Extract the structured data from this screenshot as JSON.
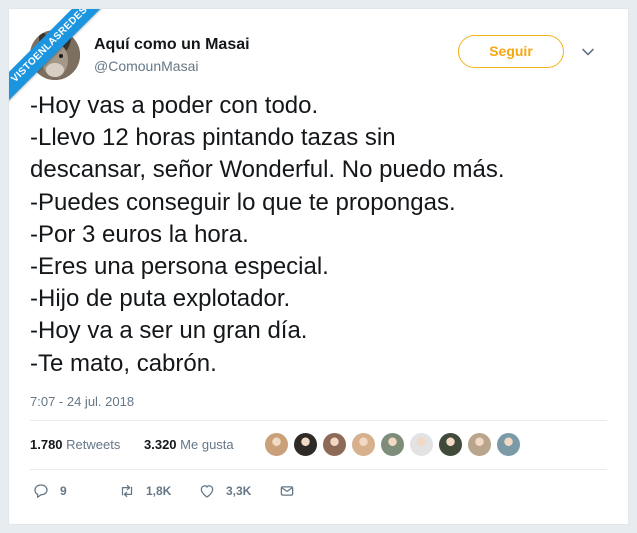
{
  "watermark": "VISTOENLASREDES",
  "author": {
    "name": "Aquí como un Masai",
    "handle": "@ComounMasai"
  },
  "follow_label": "Seguir",
  "tweet_lines": [
    "-Hoy vas a poder con todo.",
    "-Llevo 12 horas pintando tazas sin",
    "descansar, señor Wonderful. No puedo más.",
    "-Puedes conseguir lo que te propongas.",
    "-Por 3 euros la hora.",
    "-Eres una persona especial.",
    "-Hijo de puta explotador.",
    "-Hoy va a ser un gran día.",
    "-Te mato, cabrón."
  ],
  "timestamp": "7:07 - 24 jul. 2018",
  "stats": {
    "retweets_count": "1.780",
    "retweets_label": "Retweets",
    "likes_count": "3.320",
    "likes_label": "Me gusta"
  },
  "liker_avatar_colors": [
    "#c9a07a",
    "#2e2a28",
    "#8d6a58",
    "#d7b08e",
    "#7e8d7a",
    "#e3e3e3",
    "#3f4a3a",
    "#b9a58c",
    "#7a9aa8"
  ],
  "actions": {
    "replies": "9",
    "retweets": "1,8K",
    "likes": "3,3K"
  },
  "colors": {
    "follow_accent": "#f6a70f",
    "ribbon": "#1b95e0",
    "secondary_text": "#657786"
  }
}
